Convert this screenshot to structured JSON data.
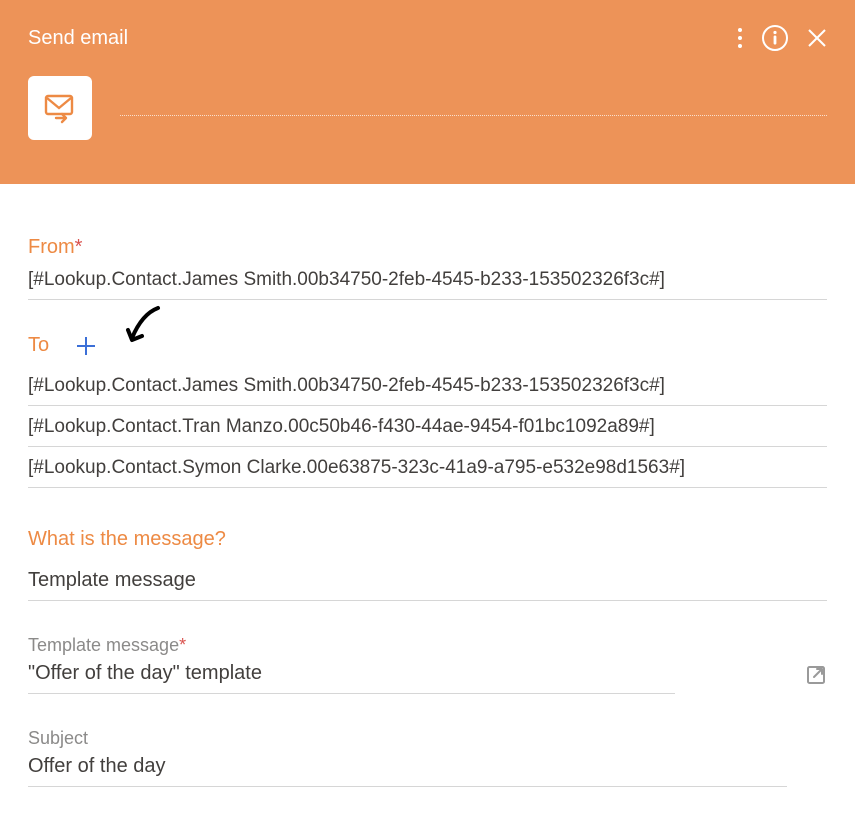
{
  "header": {
    "title": "Send email"
  },
  "from": {
    "label": "From",
    "value": "[#Lookup.Contact.James Smith.00b34750-2feb-4545-b233-153502326f3c#]"
  },
  "to": {
    "label": "To",
    "recipients": [
      "[#Lookup.Contact.James Smith.00b34750-2feb-4545-b233-153502326f3c#]",
      "[#Lookup.Contact.Tran Manzo.00c50b46-f430-44ae-9454-f01bc1092a89#]",
      "[#Lookup.Contact.Symon Clarke.00e63875-323c-41a9-a795-e532e98d1563#]"
    ]
  },
  "message": {
    "question": "What is the message?",
    "value": "Template message"
  },
  "template": {
    "label": "Template message",
    "value": "\"Offer of the day\" template"
  },
  "subject": {
    "label": "Subject",
    "value": "Offer of the day"
  }
}
